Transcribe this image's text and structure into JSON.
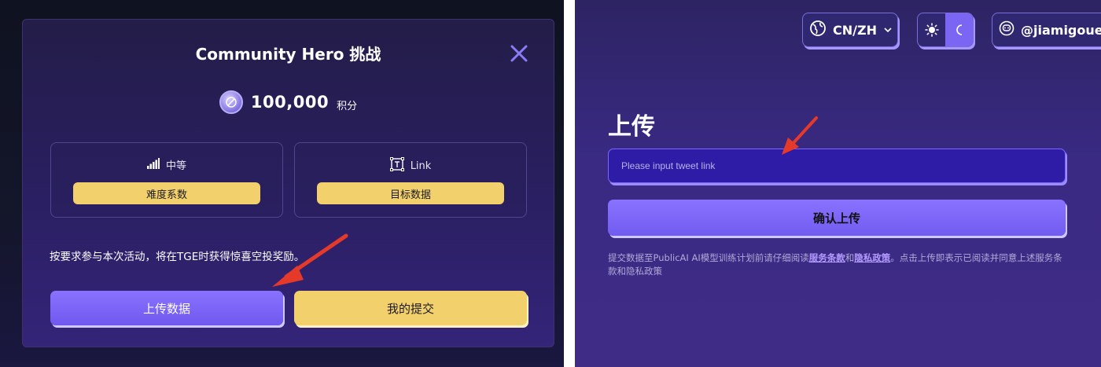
{
  "left": {
    "modal": {
      "title": "Community Hero 挑战",
      "points_value": "100,000",
      "points_unit": "积分",
      "cards": [
        {
          "head_label": "中等",
          "icon": "signal-bars-icon",
          "pill_label": "难度系数"
        },
        {
          "head_label": "Link",
          "icon": "text-box-icon",
          "pill_label": "目标数据"
        }
      ],
      "description": "按要求参与本次活动，将在TGE时获得惊喜空投奖励。",
      "upload_button": "上传数据",
      "my_submissions_button": "我的提交"
    }
  },
  "right": {
    "header": {
      "language": "CN/ZH",
      "username": "@jiamigouer"
    },
    "upload_title": "上传",
    "tweet_input": {
      "placeholder": "Please input tweet link",
      "value": ""
    },
    "confirm_button": "确认上传",
    "terms": {
      "prefix": "提交数据至PublicAI AI模型训练计划前请仔细阅读",
      "link_service": "服务条款",
      "and": "和",
      "link_privacy": "隐私政策",
      "suffix": "。点击上传即表示已阅读并同意上述服务条款和隐私政策"
    }
  },
  "colors": {
    "accent_purple": "#7a66f2",
    "accent_yellow": "#f2d06b",
    "annotation_arrow": "#e53a2a"
  }
}
